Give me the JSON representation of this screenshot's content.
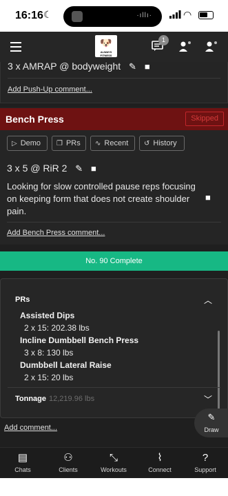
{
  "status_bar": {
    "time": "16:16"
  },
  "header": {
    "logo_text": "ALWAYS FITNESS",
    "notification_count": "1"
  },
  "pushup": {
    "sets": "3 x AMRAP @ bodyweight",
    "comment_link": "Add Push-Up comment..."
  },
  "bench": {
    "title": "Bench Press",
    "status": "Skipped",
    "tabs": [
      {
        "label": "Demo",
        "icon": "play-icon"
      },
      {
        "label": "PRs",
        "icon": "copy-icon"
      },
      {
        "label": "Recent",
        "icon": "trend-icon"
      },
      {
        "label": "History",
        "icon": "history-icon"
      }
    ],
    "sets": "3 x 5 @ RiR 2",
    "comment": "Looking for slow controlled pause reps focusing on keeping form that does not create shoulder pain.",
    "comment_link": "Add Bench Press comment..."
  },
  "complete_banner": "No. 90 Complete",
  "prs": {
    "label": "PRs",
    "items": [
      {
        "name": "Assisted Dips",
        "value": "2 x 15: 202.38 lbs"
      },
      {
        "name": "Incline Dumbbell Bench Press",
        "value": "3 x 8: 130 lbs"
      },
      {
        "name": "Dumbbell Lateral Raise",
        "value": "2 x 15: 20 lbs"
      }
    ],
    "tonnage_label": "Tonnage",
    "tonnage_value": "12,219.96 lbs"
  },
  "add_comment": "Add comment...",
  "draw_label": "Draw",
  "nav": [
    {
      "label": "Chats",
      "icon": "chat-icon"
    },
    {
      "label": "Clients",
      "icon": "clients-icon"
    },
    {
      "label": "Workouts",
      "icon": "dumbbell-icon"
    },
    {
      "label": "Connect",
      "icon": "connect-icon"
    },
    {
      "label": "Support",
      "icon": "help-icon"
    }
  ],
  "colors": {
    "skipped_header": "#6e1212",
    "complete_green": "#17b884",
    "background": "#1f1f1f"
  }
}
